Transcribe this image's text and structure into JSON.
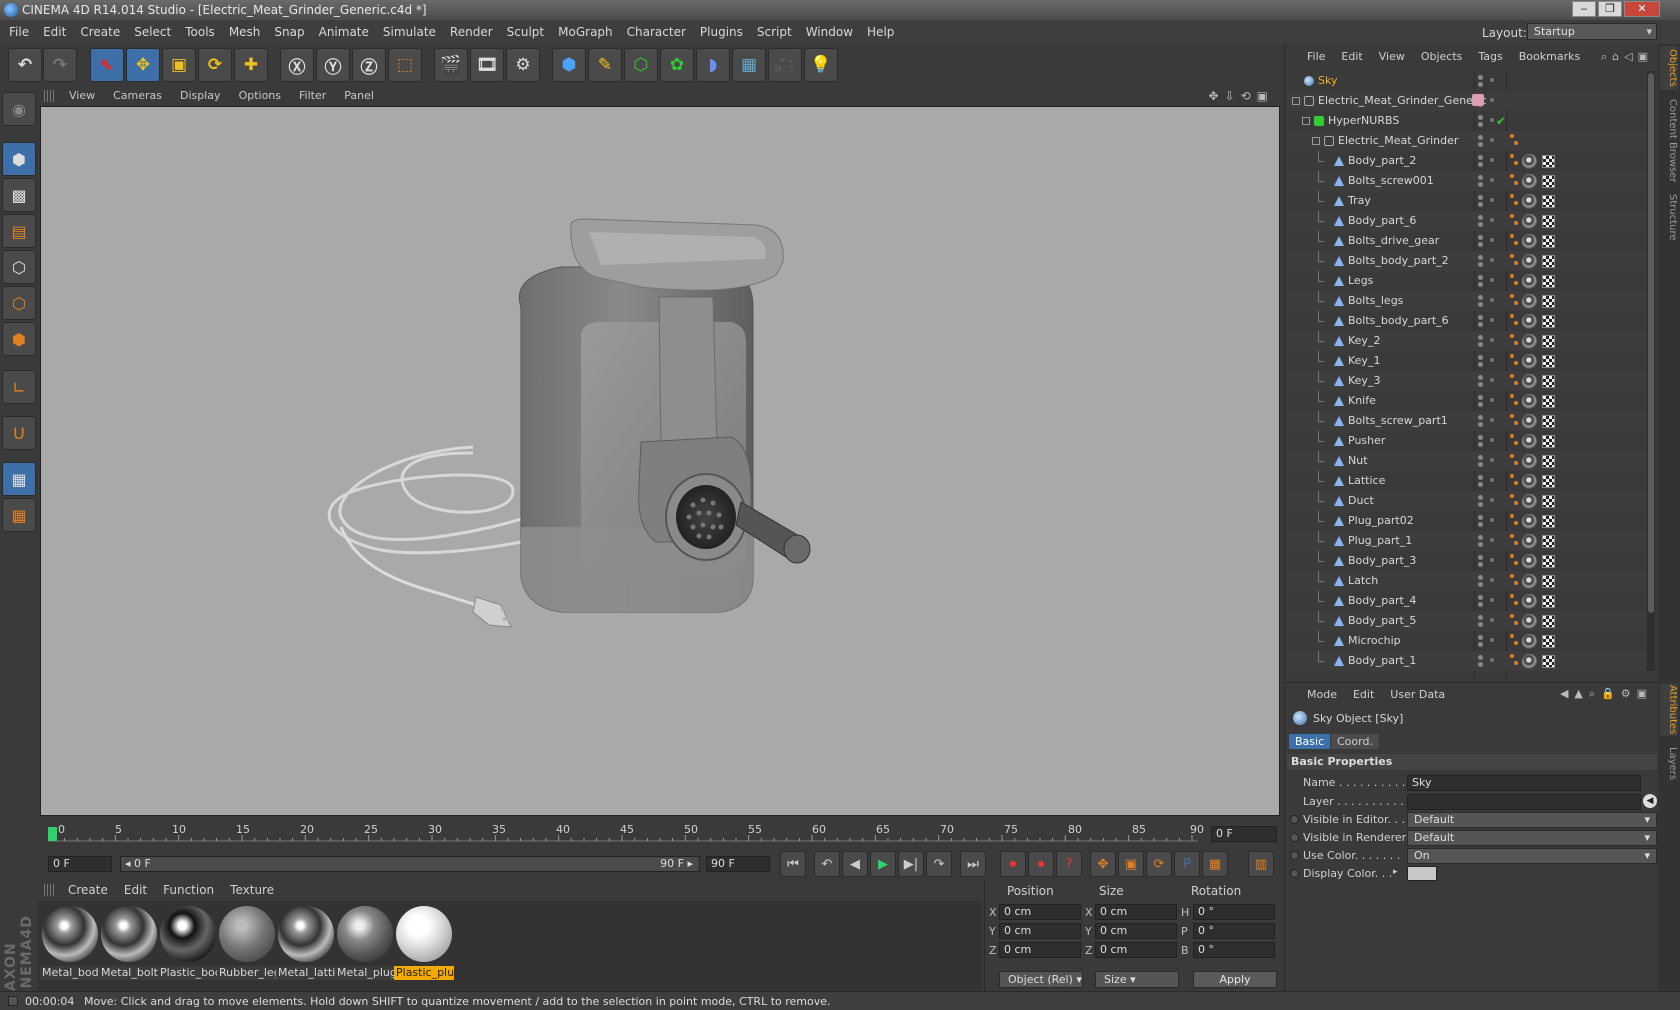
{
  "window": {
    "title": "CINEMA 4D R14.014 Studio - [Electric_Meat_Grinder_Generic.c4d *]",
    "controls": [
      "‒",
      "❐",
      "✕"
    ]
  },
  "menubar": [
    "File",
    "Edit",
    "Create",
    "Select",
    "Tools",
    "Mesh",
    "Snap",
    "Animate",
    "Simulate",
    "Render",
    "Sculpt",
    "MoGraph",
    "Character",
    "Plugins",
    "Script",
    "Window",
    "Help"
  ],
  "layout": {
    "label": "Layout:",
    "value": "Startup"
  },
  "viewport": {
    "menu": [
      "View",
      "Cameras",
      "Display",
      "Options",
      "Filter",
      "Panel"
    ],
    "icons": "✥⇩⟲▣"
  },
  "timeline": {
    "ticks": [
      "0",
      "5",
      "10",
      "15",
      "20",
      "25",
      "30",
      "35",
      "40",
      "45",
      "50",
      "55",
      "60",
      "65",
      "70",
      "75",
      "80",
      "85",
      "90"
    ],
    "end_field": "0 F"
  },
  "transport": {
    "start": "0 F",
    "range_start": "◂ 0 F",
    "range_end": "90 F ▸",
    "end": "90 F"
  },
  "materials": {
    "menu": [
      "Create",
      "Edit",
      "Function",
      "Texture"
    ],
    "items": [
      {
        "label": "Metal_bod",
        "kind": "chrome"
      },
      {
        "label": "Metal_bolt",
        "kind": "chrome"
      },
      {
        "label": "Plastic_boc",
        "kind": "dark"
      },
      {
        "label": "Rubber_leg",
        "kind": "gray"
      },
      {
        "label": "Metal_latti",
        "kind": "chrome"
      },
      {
        "label": "Metal_plug",
        "kind": "gray"
      },
      {
        "label": "Plastic_plu",
        "kind": "white",
        "selected": true
      }
    ]
  },
  "coords": {
    "headers": [
      "Position",
      "Size",
      "Rotation"
    ],
    "rows": [
      {
        "axis": "X",
        "pos": "0 cm",
        "size_axis": "X",
        "size": "0 cm",
        "rot_axis": "H",
        "rot": "0 °"
      },
      {
        "axis": "Y",
        "pos": "0 cm",
        "size_axis": "Y",
        "size": "0 cm",
        "rot_axis": "P",
        "rot": "0 °"
      },
      {
        "axis": "Z",
        "pos": "0 cm",
        "size_axis": "Z",
        "size": "0 cm",
        "rot_axis": "B",
        "rot": "0 °"
      }
    ],
    "mode": "Object (Rel) ▾",
    "size_mode": "Size ▾",
    "apply": "Apply"
  },
  "status": {
    "time": "00:00:04",
    "message": "Move: Click and drag to move elements. Hold down SHIFT to quantize movement / add to the selection in point mode, CTRL to remove."
  },
  "object_manager": {
    "menu": [
      "File",
      "Edit",
      "View",
      "Objects",
      "Tags",
      "Bookmarks"
    ],
    "objects": [
      {
        "name": "Sky",
        "indent": 0,
        "icon": "sky",
        "highlight": true
      },
      {
        "name": "Electric_Meat_Grinder_Generic",
        "indent": 0,
        "icon": "null",
        "tag": "pink"
      },
      {
        "name": "HyperNURBS",
        "indent": 1,
        "icon": "hypernurbs",
        "check": true
      },
      {
        "name": "Electric_Meat_Grinder",
        "indent": 2,
        "icon": "null"
      },
      {
        "name": "Body_part_2",
        "indent": 3,
        "icon": "poly"
      },
      {
        "name": "Bolts_screw001",
        "indent": 3,
        "icon": "poly"
      },
      {
        "name": "Tray",
        "indent": 3,
        "icon": "poly"
      },
      {
        "name": "Body_part_6",
        "indent": 3,
        "icon": "poly"
      },
      {
        "name": "Bolts_drive_gear",
        "indent": 3,
        "icon": "poly"
      },
      {
        "name": "Bolts_body_part_2",
        "indent": 3,
        "icon": "poly"
      },
      {
        "name": "Legs",
        "indent": 3,
        "icon": "poly"
      },
      {
        "name": "Bolts_legs",
        "indent": 3,
        "icon": "poly"
      },
      {
        "name": "Bolts_body_part_6",
        "indent": 3,
        "icon": "poly"
      },
      {
        "name": "Key_2",
        "indent": 3,
        "icon": "poly"
      },
      {
        "name": "Key_1",
        "indent": 3,
        "icon": "poly"
      },
      {
        "name": "Key_3",
        "indent": 3,
        "icon": "poly"
      },
      {
        "name": "Knife",
        "indent": 3,
        "icon": "poly"
      },
      {
        "name": "Bolts_screw_part1",
        "indent": 3,
        "icon": "poly"
      },
      {
        "name": "Pusher",
        "indent": 3,
        "icon": "poly"
      },
      {
        "name": "Nut",
        "indent": 3,
        "icon": "poly"
      },
      {
        "name": "Lattice",
        "indent": 3,
        "icon": "poly"
      },
      {
        "name": "Duct",
        "indent": 3,
        "icon": "poly"
      },
      {
        "name": "Plug_part02",
        "indent": 3,
        "icon": "poly"
      },
      {
        "name": "Plug_part_1",
        "indent": 3,
        "icon": "poly"
      },
      {
        "name": "Body_part_3",
        "indent": 3,
        "icon": "poly"
      },
      {
        "name": "Latch",
        "indent": 3,
        "icon": "poly"
      },
      {
        "name": "Body_part_4",
        "indent": 3,
        "icon": "poly"
      },
      {
        "name": "Body_part_5",
        "indent": 3,
        "icon": "poly"
      },
      {
        "name": "Microchip",
        "indent": 3,
        "icon": "poly"
      },
      {
        "name": "Body_part_1",
        "indent": 3,
        "icon": "poly"
      }
    ]
  },
  "side_tabs_top": [
    "Objects",
    "Content Browser",
    "Structure"
  ],
  "side_tabs_bottom": [
    "Attributes",
    "Layers"
  ],
  "attributes": {
    "menu": [
      "Mode",
      "Edit",
      "User Data"
    ],
    "title": "Sky Object [Sky]",
    "tabs": [
      "Basic",
      "Coord."
    ],
    "section": "Basic Properties",
    "fields": [
      {
        "label": "Name . . . . . . . . . . .",
        "value": "Sky",
        "type": "text"
      },
      {
        "label": "Layer . . . . . . . . . . .",
        "value": "",
        "type": "text"
      },
      {
        "label": "Visible in Editor. . .",
        "value": "Default",
        "type": "select"
      },
      {
        "label": "Visible in Renderer",
        "value": "Default",
        "type": "select"
      },
      {
        "label": "Use Color. . . . . . .",
        "value": "On",
        "type": "select"
      },
      {
        "label": "Display Color. . .",
        "value": "",
        "type": "color"
      }
    ]
  },
  "colors": {
    "accent": "#3d6fa8",
    "selected_material": "#f2a900",
    "orange_dot": "#e08020"
  }
}
